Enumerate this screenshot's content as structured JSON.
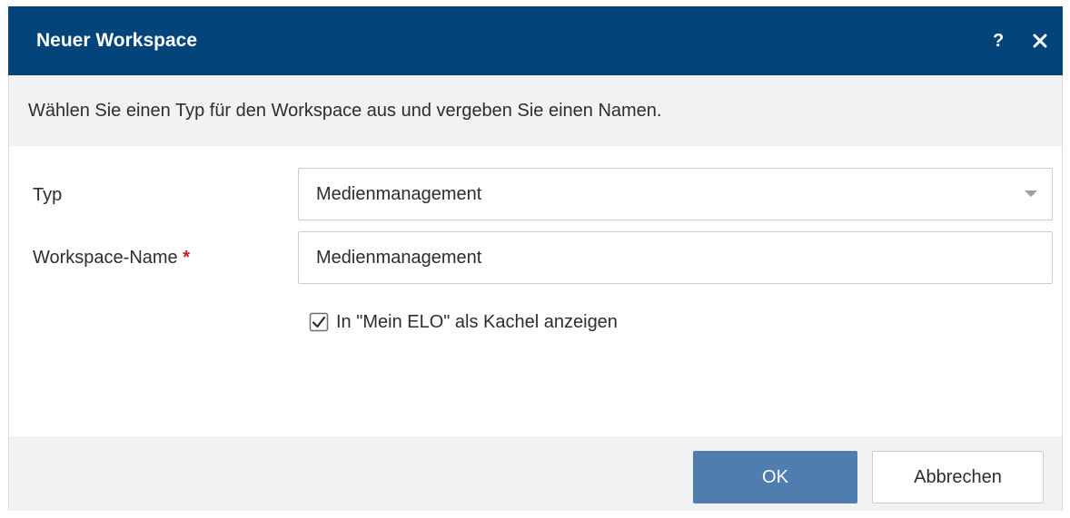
{
  "dialog": {
    "title": "Neuer Workspace",
    "help_label": "?",
    "description": "Wählen Sie einen Typ für den Workspace aus und vergeben Sie einen Namen."
  },
  "form": {
    "type_label": "Typ",
    "type_value": "Medienmanagement",
    "name_label": "Workspace-Name",
    "required_marker": "*",
    "name_value": "Medienmanagement",
    "tile_checkbox_label": "In \"Mein ELO\" als Kachel anzeigen",
    "tile_checkbox_checked": true
  },
  "buttons": {
    "ok_label": "OK",
    "cancel_label": "Abbrechen"
  },
  "colors": {
    "titlebar": "#03447a",
    "primary_button": "#4f7db0",
    "required": "#d41d1d",
    "panel_background": "#f1f2f4"
  }
}
